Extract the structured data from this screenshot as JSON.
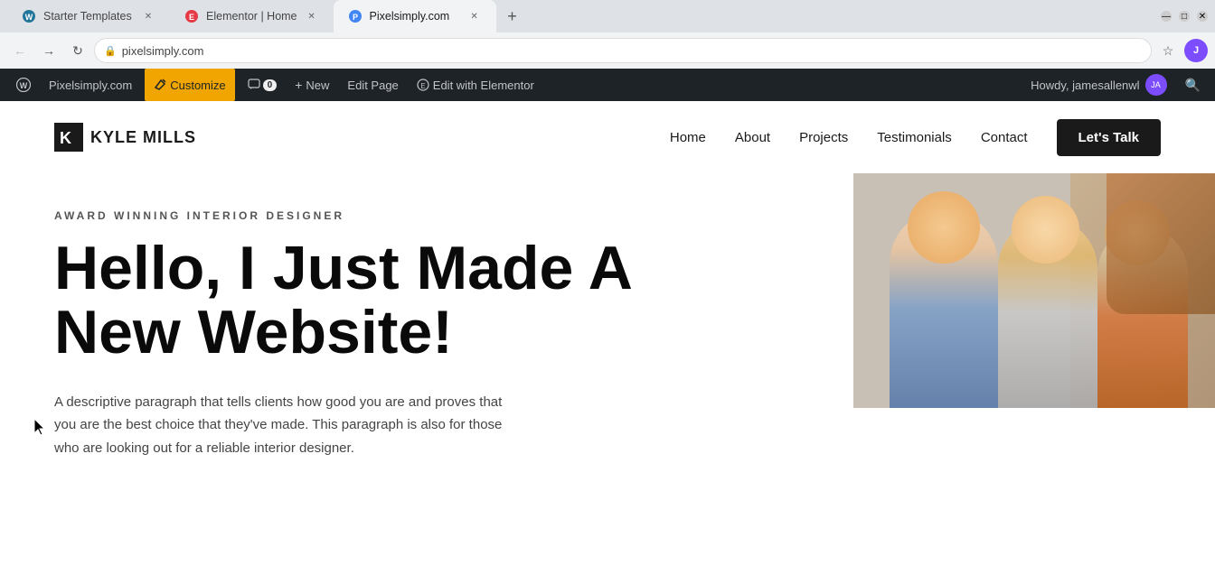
{
  "browser": {
    "tabs": [
      {
        "id": "tab1",
        "title": "Starter Templates",
        "favicon": "W",
        "favicon_color": "#4285f4",
        "active": false
      },
      {
        "id": "tab2",
        "title": "Elementor | Home",
        "favicon": "E",
        "favicon_color": "#e63946",
        "active": false
      },
      {
        "id": "tab3",
        "title": "Pixelsimply.com",
        "favicon": "P",
        "favicon_color": "#4285f4",
        "active": true
      }
    ],
    "address": "pixelsimply.com",
    "lock_symbol": "🔒"
  },
  "wp_admin_bar": {
    "wp_logo_title": "WordPress",
    "site_name": "Pixelsimply.com",
    "customize_label": "Customize",
    "comments_label": "0",
    "new_label": "New",
    "edit_page_label": "Edit Page",
    "edit_with_elementor_label": "Edit with Elementor",
    "howdy_text": "Howdy, jamesallenwl"
  },
  "site": {
    "logo_text": "KYLE MILLS",
    "nav_links": [
      {
        "label": "Home",
        "href": "#"
      },
      {
        "label": "About",
        "href": "#"
      },
      {
        "label": "Projects",
        "href": "#"
      },
      {
        "label": "Testimonials",
        "href": "#"
      },
      {
        "label": "Contact",
        "href": "#"
      }
    ],
    "cta_label": "Let's Talk",
    "hero": {
      "subtitle": "AWARD WINNING INTERIOR DESIGNER",
      "title_line1": "Hello, I Just Made A",
      "title_line2": "New Website!",
      "description": "A descriptive paragraph that tells clients how good you are and proves that you are the best choice that they've made. This paragraph is also for those who are looking out for a reliable interior designer."
    }
  }
}
